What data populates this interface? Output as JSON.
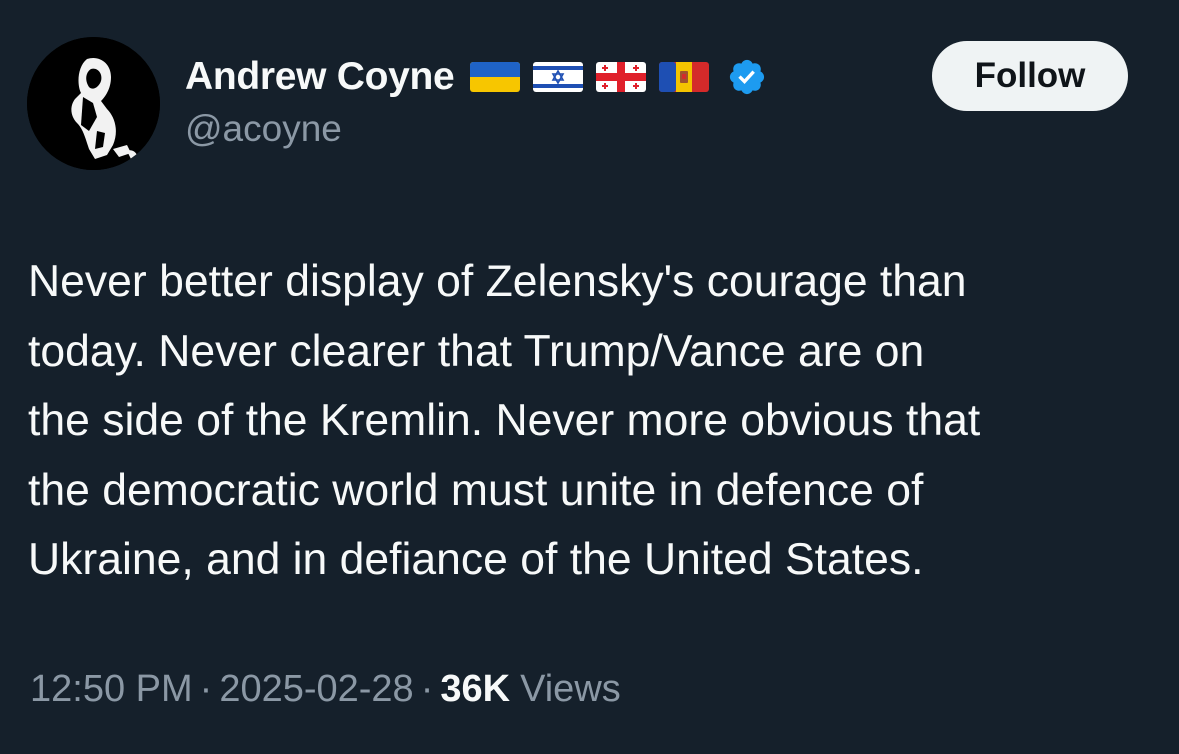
{
  "author": {
    "display_name": "Andrew Coyne",
    "handle": "@acoyne",
    "verified": true,
    "flags": [
      "ukraine-flag",
      "israel-flag",
      "georgia-flag",
      "moldova-flag"
    ]
  },
  "follow_button": {
    "label": "Follow"
  },
  "tweet": {
    "lines": [
      "Never better display of Zelensky's courage than",
      "today. Never clearer that Trump/Vance are on",
      "the side of the Kremlin. Never more obvious that",
      "the democratic world must unite in defence of",
      "Ukraine, and in defiance of the United States."
    ]
  },
  "meta": {
    "time": "12:50 PM",
    "separator": "·",
    "date": "2025-02-28",
    "views_count": "36K",
    "views_label": "Views"
  },
  "colors": {
    "background": "#15202b",
    "text_primary": "#f7f9f9",
    "text_secondary": "#8b98a5",
    "verified_badge": "#1d9bf0",
    "follow_button_bg": "#eff3f4"
  }
}
